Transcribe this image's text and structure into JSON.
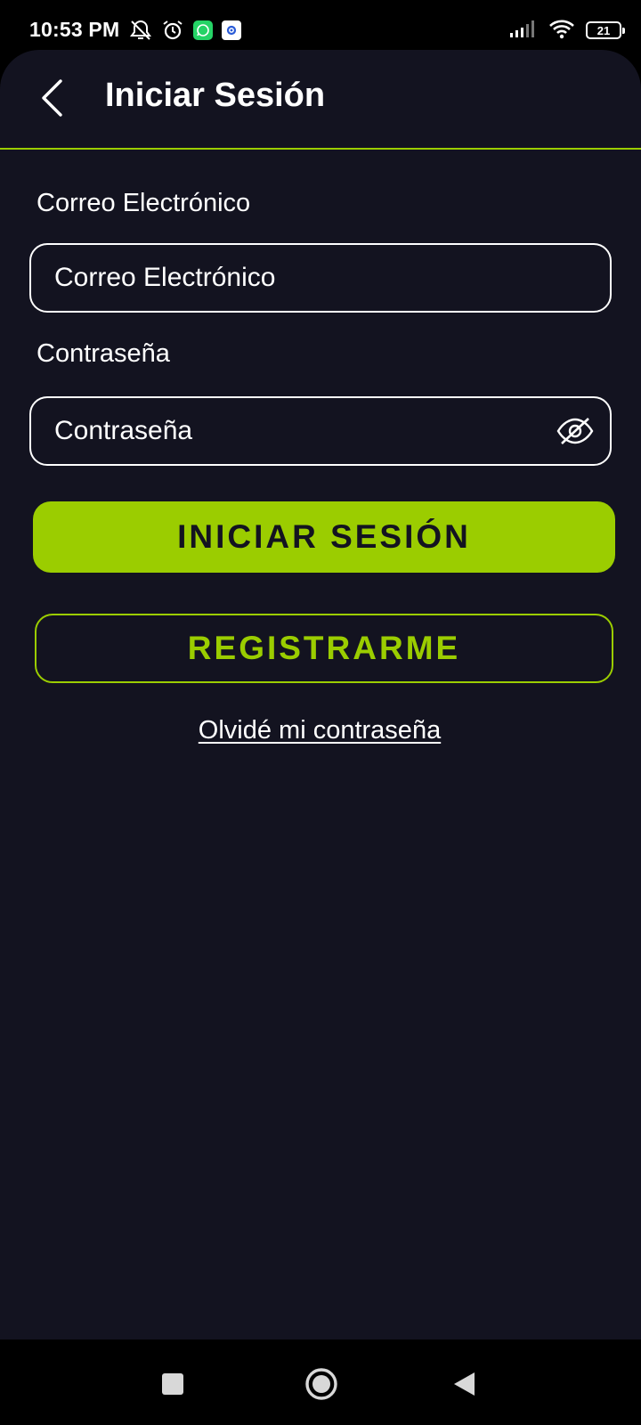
{
  "status_bar": {
    "time": "10:53 PM",
    "battery": "21",
    "icons_left": [
      "alarm-off-icon",
      "alarm-clock-icon",
      "whatsapp-icon",
      "app-gear-icon"
    ],
    "icons_right": [
      "signal-icon",
      "wifi-icon",
      "battery-icon"
    ]
  },
  "header": {
    "back_icon": "chevron-left-icon",
    "title": "Iniciar Sesión"
  },
  "form": {
    "email_label": "Correo Electrónico",
    "email_placeholder": "Correo Electrónico",
    "email_value": "",
    "password_label": "Contraseña",
    "password_placeholder": "Contraseña",
    "password_value": "",
    "password_toggle_icon": "eye-off-icon"
  },
  "actions": {
    "login_label": "INICIAR SESIÓN",
    "register_label": "REGISTRARME",
    "forgot_label": "Olvidé mi contraseña"
  },
  "nav_bar": {
    "icons": [
      "square-icon",
      "circle-home-icon",
      "triangle-back-icon"
    ]
  },
  "colors": {
    "background": "#131320",
    "accent": "#9bcd00",
    "text": "#ffffff"
  }
}
